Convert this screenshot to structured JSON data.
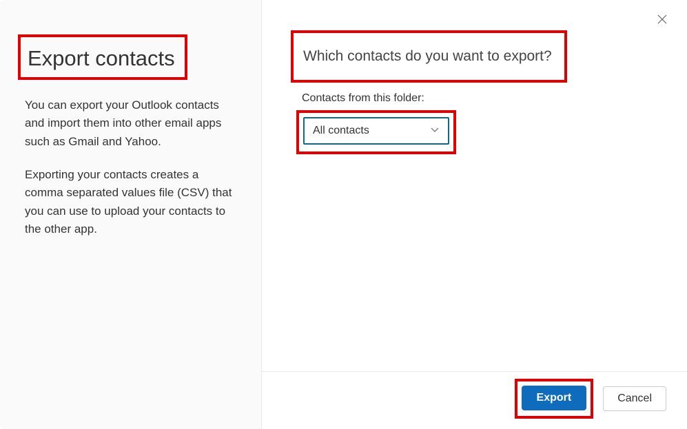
{
  "left": {
    "title": "Export contacts",
    "desc1": "You can export your Outlook contacts and import them into other email apps such as Gmail and Yahoo.",
    "desc2": "Exporting your contacts creates a comma separated values file (CSV) that you can use to upload your contacts to the other app."
  },
  "right": {
    "question": "Which contacts do you want to export?",
    "folder_label": "Contacts from this folder:",
    "selected_folder": "All contacts"
  },
  "footer": {
    "export_label": "Export",
    "cancel_label": "Cancel"
  }
}
